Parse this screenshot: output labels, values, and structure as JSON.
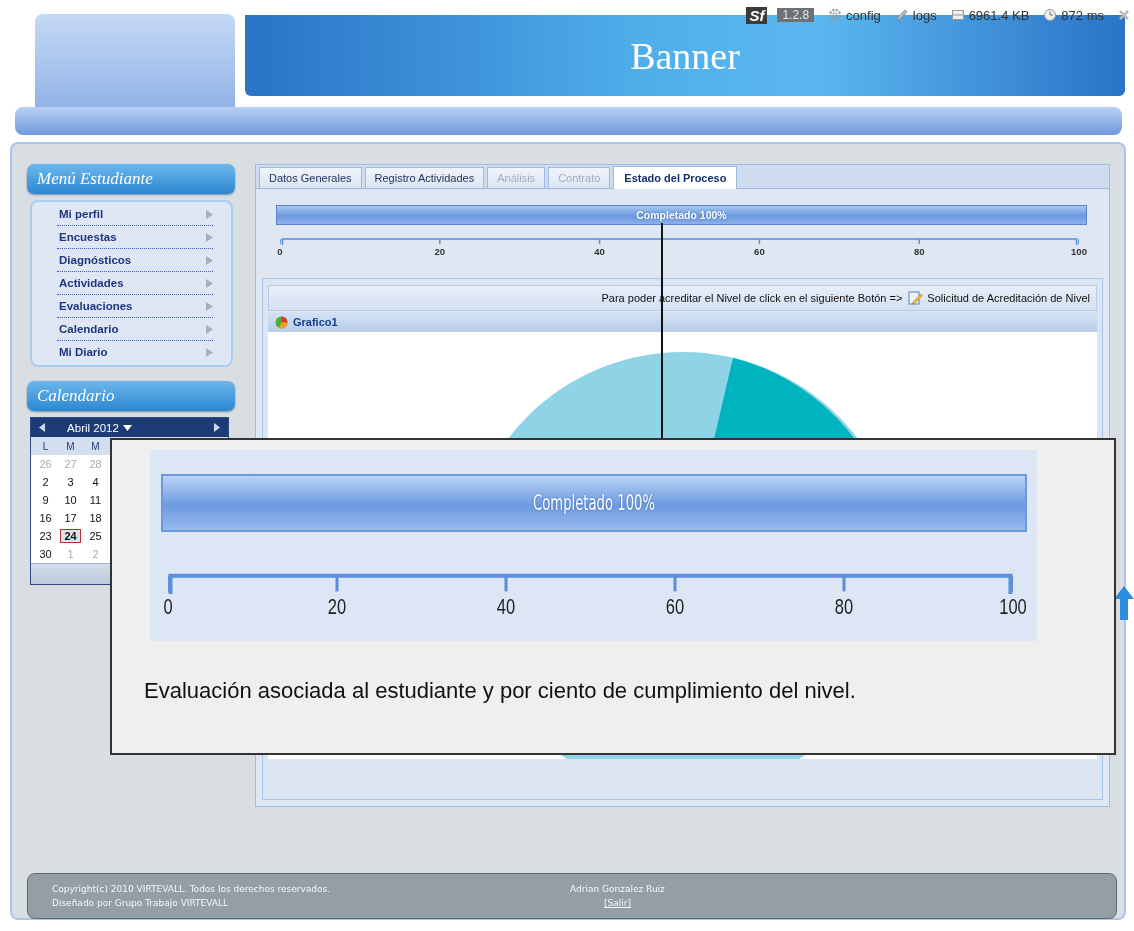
{
  "debug_bar": {
    "logo": "Sf",
    "version": "1.2.8",
    "items": [
      {
        "kind": "config",
        "label": "config"
      },
      {
        "kind": "logs",
        "label": "logs"
      },
      {
        "kind": "memory",
        "label": "6961.4 KB"
      },
      {
        "kind": "time",
        "label": "872 ms"
      }
    ]
  },
  "banner": {
    "title": "Banner"
  },
  "sidebar": {
    "menu_title": "Menú Estudiante",
    "items": [
      {
        "label": "Mi perfil"
      },
      {
        "label": "Encuestas"
      },
      {
        "label": "Diagnósticos"
      },
      {
        "label": "Actividades"
      },
      {
        "label": "Evaluaciones"
      },
      {
        "label": "Calendario"
      },
      {
        "label": "Mi Diario"
      }
    ],
    "calendar_title": "Calendario",
    "calendar": {
      "month": "Abril 2012",
      "weekdays": [
        "L",
        "M",
        "M"
      ],
      "weeks": [
        [
          {
            "day": "26",
            "other_month": true,
            "selected": false
          },
          {
            "day": "27",
            "other_month": true,
            "selected": false
          },
          {
            "day": "28",
            "other_month": true,
            "selected": false
          }
        ],
        [
          {
            "day": "2",
            "other_month": false,
            "selected": false
          },
          {
            "day": "3",
            "other_month": false,
            "selected": false
          },
          {
            "day": "4",
            "other_month": false,
            "selected": false
          }
        ],
        [
          {
            "day": "9",
            "other_month": false,
            "selected": false
          },
          {
            "day": "10",
            "other_month": false,
            "selected": false
          },
          {
            "day": "11",
            "other_month": false,
            "selected": false
          }
        ],
        [
          {
            "day": "16",
            "other_month": false,
            "selected": false
          },
          {
            "day": "17",
            "other_month": false,
            "selected": false
          },
          {
            "day": "18",
            "other_month": false,
            "selected": false
          }
        ],
        [
          {
            "day": "23",
            "other_month": false,
            "selected": false
          },
          {
            "day": "24",
            "other_month": false,
            "selected": true
          },
          {
            "day": "25",
            "other_month": false,
            "selected": false
          }
        ],
        [
          {
            "day": "30",
            "other_month": false,
            "selected": false
          },
          {
            "day": "1",
            "other_month": true,
            "selected": false
          },
          {
            "day": "2",
            "other_month": true,
            "selected": false
          }
        ]
      ]
    }
  },
  "tabs": [
    {
      "label": "Datos Generales",
      "disabled": false,
      "selected": false
    },
    {
      "label": "Registro Actividades",
      "disabled": false,
      "selected": false
    },
    {
      "label": "Análisis",
      "disabled": true,
      "selected": false
    },
    {
      "label": "Contrato",
      "disabled": true,
      "selected": false
    },
    {
      "label": "Estado del Proceso",
      "disabled": false,
      "selected": true
    }
  ],
  "progress": {
    "label": "Completado 100%",
    "level": 1,
    "ticks": [
      "0",
      "20",
      "40",
      "60",
      "80",
      "100"
    ]
  },
  "notice": {
    "text": "Para poder acreditar el Nivel de click en el siguiente Botón =>",
    "button": "Solicitud de Acreditación de Nivel"
  },
  "chart_panel": {
    "title": "Grafico1"
  },
  "callout": {
    "progress": {
      "label": "Completado 100%",
      "level": 1,
      "ticks": [
        "0",
        "20",
        "40",
        "60",
        "80",
        "100"
      ]
    },
    "caption": "Evaluación asociada al estudiante y por ciento de cumplimiento del nivel."
  },
  "footer": {
    "copyright": "Copyright(c) 2010 VIRTEVALL. Todos los derechos reservados.",
    "designed": "Diseñado por Grupo Trabajo VIRTEVALL",
    "user": "Adrian Gonzalez Ruiz",
    "logout": "[Salir]"
  }
}
